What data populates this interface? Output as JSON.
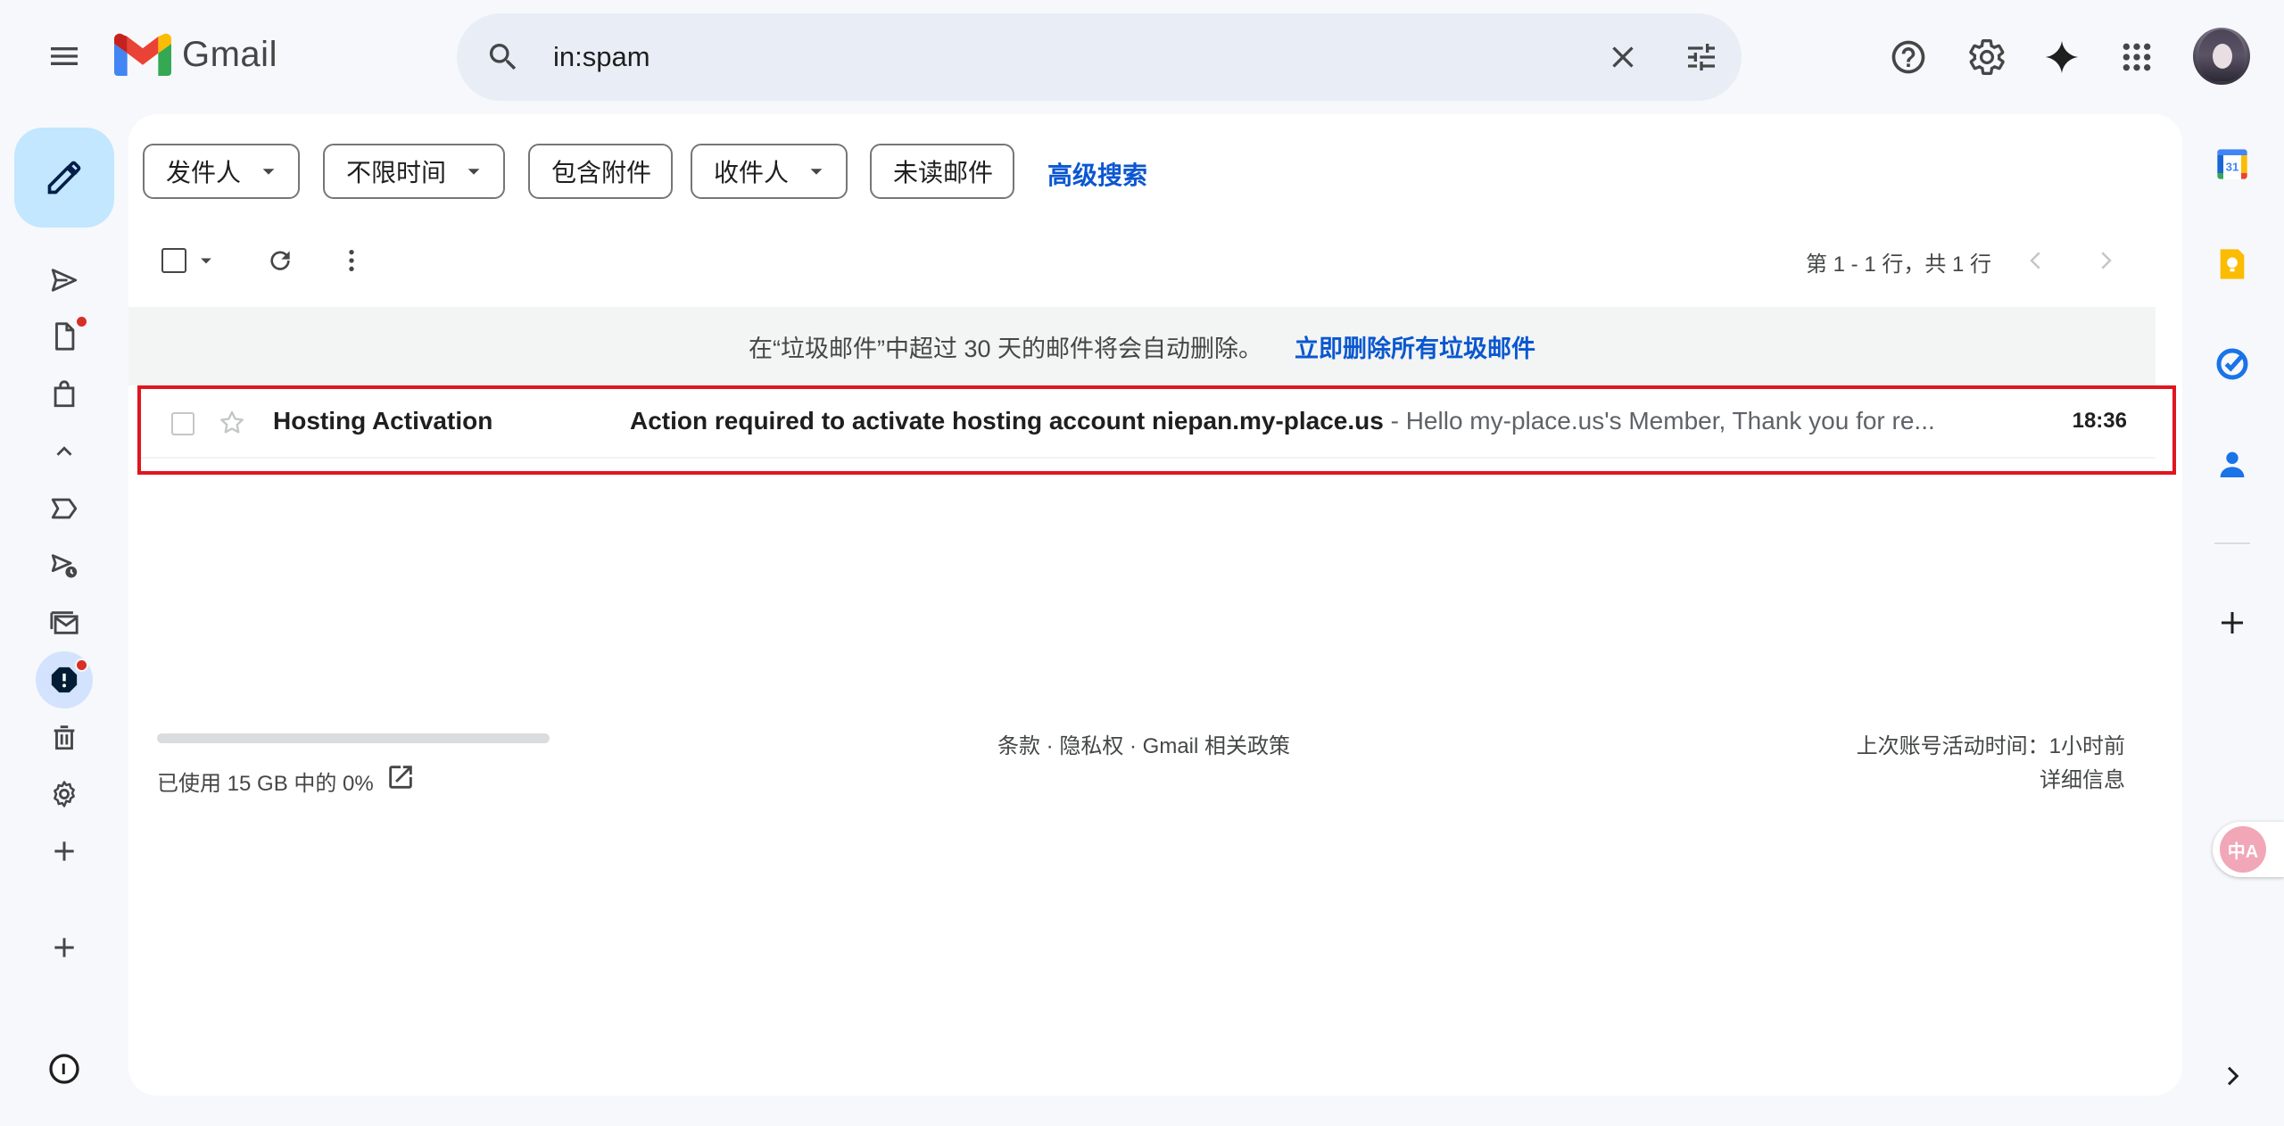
{
  "header": {
    "app_name": "Gmail",
    "search_value": "in:spam",
    "icons": [
      "menu-icon",
      "search-icon",
      "clear-search-icon",
      "search-options-icon",
      "help-icon",
      "settings-icon",
      "gemini-icon",
      "apps-grid-icon"
    ]
  },
  "filters": {
    "chips": [
      {
        "label": "发件人",
        "dropdown": true
      },
      {
        "label": "不限时间",
        "dropdown": true
      },
      {
        "label": "包含附件",
        "dropdown": false
      },
      {
        "label": "收件人",
        "dropdown": true
      },
      {
        "label": "未读邮件",
        "dropdown": false
      }
    ],
    "advanced_search": "高级搜索"
  },
  "toolbar": {
    "pager_text": "第 1 - 1 行，共 1 行"
  },
  "notice": {
    "text": "在“垃圾邮件”中超过 30 天的邮件将会自动删除。",
    "action": "立即删除所有垃圾邮件"
  },
  "emails": [
    {
      "sender": "Hosting Activation",
      "subject": "Action required to activate hosting account niepan.my-place.us",
      "snippet": " - Hello my-place.us's Member, Thank you for re...",
      "time": "18:36",
      "unread": true
    }
  ],
  "footer": {
    "storage_used_fraction": 0,
    "storage_text": "已使用 15 GB 中的 0%",
    "links": "条款 · 隐私权 · Gmail 相关政策",
    "last_activity": "上次账号活动时间：1小时前",
    "details": "详细信息"
  },
  "colors": {
    "accent_blue": "#0b57d0",
    "compose_bg": "#c2e7ff",
    "highlight_red": "#e0161e",
    "badge_red": "#d93025"
  },
  "translate_fab": {
    "label": "中A"
  }
}
